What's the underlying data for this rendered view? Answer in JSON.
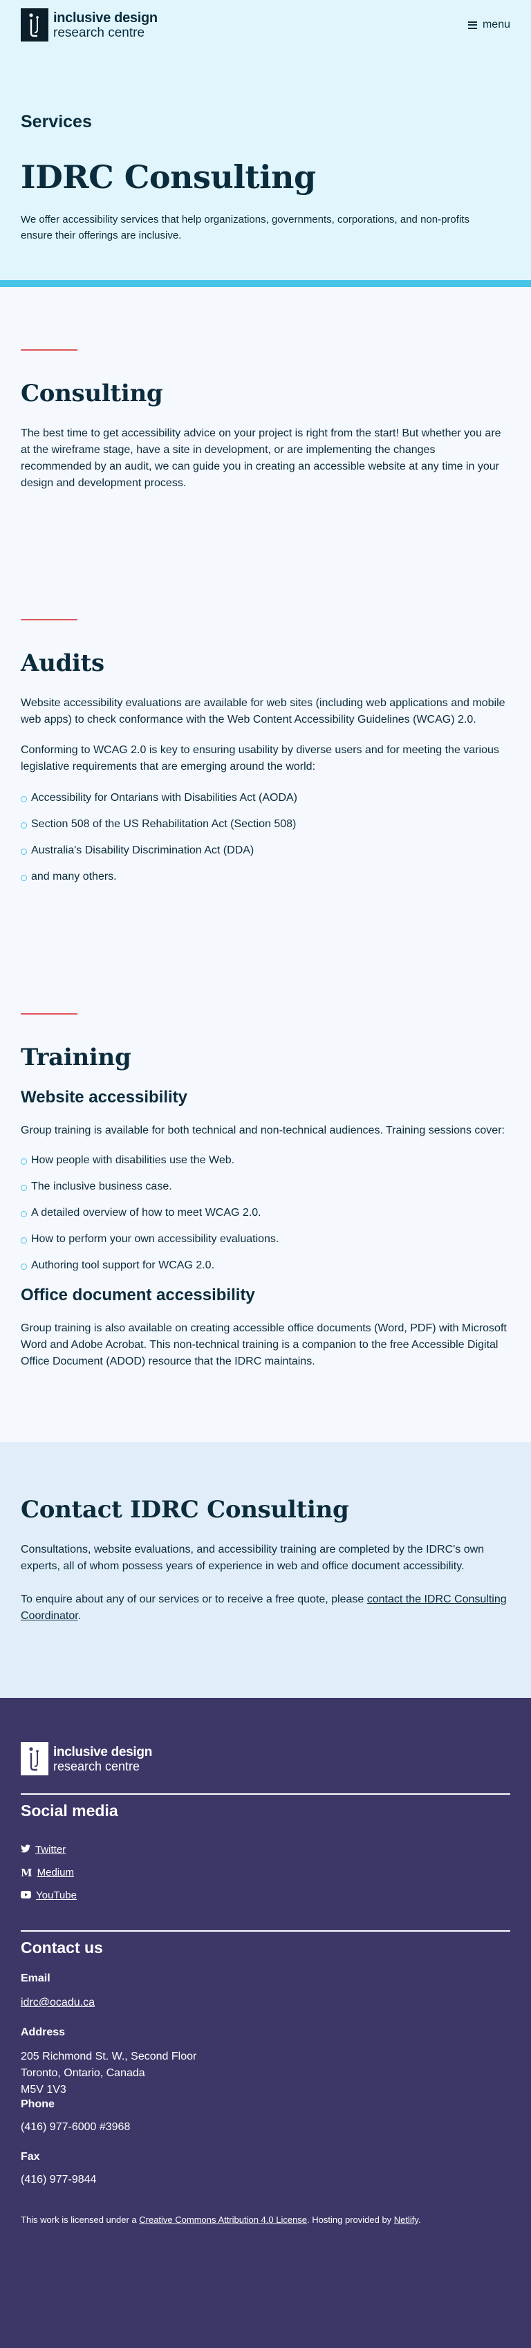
{
  "header": {
    "brand_line1": "inclusive design",
    "brand_line2": "research centre",
    "menu_label": "menu"
  },
  "hero": {
    "eyebrow": "Services",
    "title": "IDRC Consulting",
    "intro": "We offer accessibility services that help organizations, governments, corporations, and non-profits ensure their offerings are inclusive."
  },
  "consulting": {
    "title": "Consulting",
    "body": "The best time to get accessibility advice on your project is right from the start! But whether you are at the wireframe stage, have a site in development, or are implementing the changes recommended by an audit, we can guide you in creating an accessible website at any time in your design and development process."
  },
  "audits": {
    "title": "Audits",
    "p1": "Website accessibility evaluations are available for web sites (including web applications and mobile web apps) to check conformance with the Web Content Accessibility Guidelines (WCAG) 2.0.",
    "p2": "Conforming to WCAG 2.0 is key to ensuring usability by diverse users and for meeting the various legislative requirements that are emerging around the world:",
    "items": [
      "Accessibility for Ontarians with Disabilities Act (AODA)",
      "Section 508 of the US Rehabilitation Act (Section 508)",
      "Australia's Disability Discrimination Act (DDA)",
      "and many others."
    ]
  },
  "training": {
    "title": "Training",
    "web_heading": "Website accessibility",
    "web_body": "Group training is available for both technical and non-technical audiences. Training sessions cover:",
    "items": [
      "How people with disabilities use the Web.",
      "The inclusive business case.",
      "A detailed overview of how to meet WCAG 2.0.",
      "How to perform your own accessibility evaluations.",
      "Authoring tool support for WCAG 2.0."
    ],
    "office_heading": "Office document accessibility",
    "office_body": "Group training is also available on creating accessible office documents (Word, PDF) with Microsoft Word and Adobe Acrobat. This non-technical training is a companion to the free Accessible Digital Office Document (ADOD) resource that the IDRC maintains."
  },
  "contact": {
    "title": "Contact IDRC Consulting",
    "p1": "Consultations, website evaluations, and accessibility training are completed by the IDRC's own experts, all of whom possess years of experience in web and office document accessibility.",
    "p2_before": "To enquire about any of our services or to receive a free quote, please ",
    "p2_link": "contact the IDRC Consulting Coordinator",
    "p2_after": "."
  },
  "footer": {
    "brand_line1": "inclusive design",
    "brand_line2": "research centre",
    "social_heading": "Social media",
    "social": [
      {
        "label": "Twitter",
        "icon": "twitter-icon"
      },
      {
        "label": "Medium",
        "icon": "medium-icon"
      },
      {
        "label": "YouTube",
        "icon": "youtube-icon"
      }
    ],
    "contact_heading": "Contact us",
    "email_label": "Email",
    "email": "idrc@ocadu.ca",
    "address_label": "Address",
    "address_line1": "205 Richmond St. W., Second Floor",
    "address_line2": "Toronto, Ontario, Canada",
    "address_line3": "M5V 1V3",
    "phone_label": "Phone",
    "phone": "(416) 977-6000 #3968",
    "fax_label": "Fax",
    "fax": "(416) 977-9844",
    "legal_before": "This work is licensed under a ",
    "license_link": "Creative Commons Attribution 4.0 License",
    "legal_middle": ". Hosting provided by ",
    "host_link": "Netlify",
    "legal_after": "."
  },
  "colors": {
    "hero_bg": "#e1f6fc",
    "accent_band": "#48c5e6",
    "accent_rule": "#e0565a",
    "text": "#0b2c3d",
    "contact_bg": "#e1edf9",
    "footer_bg": "#3d3768"
  }
}
